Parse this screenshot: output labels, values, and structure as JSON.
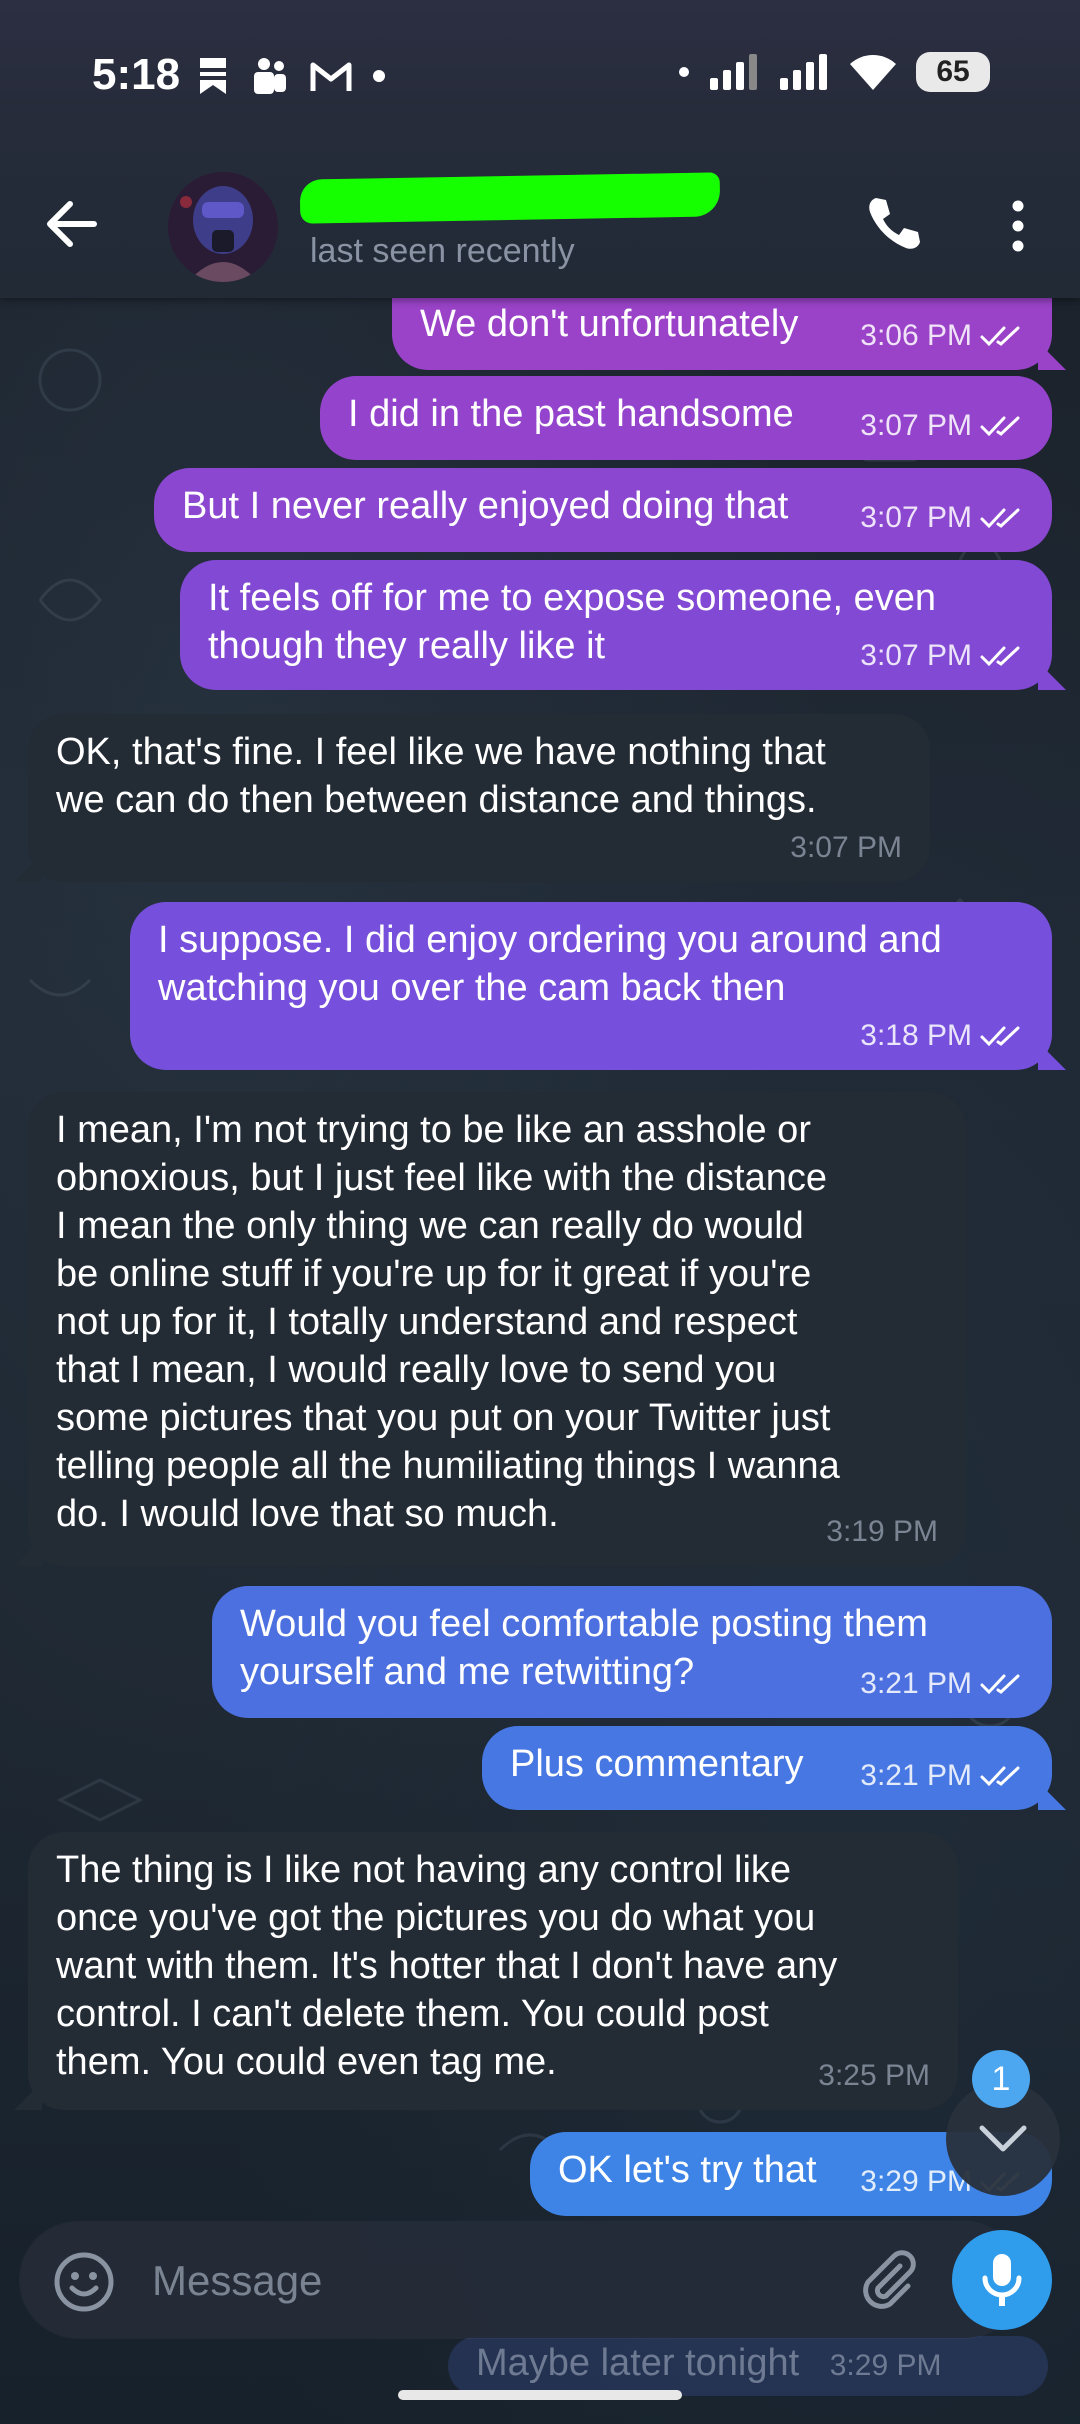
{
  "status_bar": {
    "time": "5:18",
    "battery": "65"
  },
  "header": {
    "contact_status": "last seen recently"
  },
  "messages": [
    {
      "dir": "out",
      "text": "We don't unfortunately",
      "time": "3:06 PM",
      "color": "#9a43c8"
    },
    {
      "dir": "out",
      "text": "I did in the past handsome",
      "time": "3:07 PM",
      "color": "#9444cc"
    },
    {
      "dir": "out",
      "text": "But I never really enjoyed doing that",
      "time": "3:07 PM",
      "color": "#8b47d0"
    },
    {
      "dir": "out",
      "text": "It feels off for me to expose someone, even\nthough they really like it",
      "time": "3:07 PM",
      "color": "#8249d4"
    },
    {
      "dir": "in",
      "text": "OK, that's fine. I feel like we have nothing that\nwe can do then between distance and things.",
      "time": "3:07 PM"
    },
    {
      "dir": "out",
      "text": "I suppose. I did enjoy ordering you around and\nwatching you over the cam back then",
      "time": "3:18 PM",
      "color": "#7650dc"
    },
    {
      "dir": "in",
      "text": "I mean, I'm not trying to be like an asshole or\nobnoxious, but I just feel like with the distance\nI mean the only thing we can really do would\nbe online stuff if you're up for it great if you're\nnot up for it, I totally understand and respect\nthat I mean, I would really love to send you\nsome pictures that you put on your Twitter just\ntelling people all the humiliating things I wanna\ndo. I would love that so much.",
      "time": "3:19 PM"
    },
    {
      "dir": "out",
      "text": "Would you feel comfortable posting them\nyourself and me retwitting?",
      "time": "3:21 PM",
      "color": "#4d70e0"
    },
    {
      "dir": "out",
      "text": "Plus commentary",
      "time": "3:21 PM",
      "color": "#4777e2"
    },
    {
      "dir": "in",
      "text": "The thing is I like not having any control like\nonce you've got the pictures you do what you\nwant with them. It's hotter that I don't have any\ncontrol. I can't delete them. You could post\nthem. You could even tag me.",
      "time": "3:25 PM"
    },
    {
      "dir": "out",
      "text": "OK let's try that",
      "time": "3:29 PM",
      "color": "#3e84e6"
    }
  ],
  "hidden_message": {
    "text": "Maybe later tonight",
    "time": "3:29 PM"
  },
  "input": {
    "placeholder": "Message"
  },
  "scroll": {
    "unread_count": "1"
  },
  "colors": {
    "accent": "#2f9cec",
    "incoming_bubble": "#232b35",
    "redaction": "#16ff00"
  }
}
